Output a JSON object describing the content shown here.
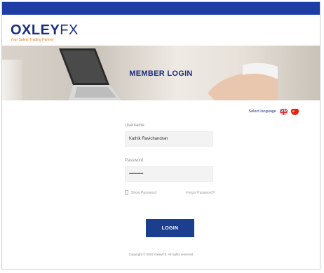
{
  "brand": {
    "name_primary": "OXLEY",
    "name_secondary": "FX",
    "tagline": "Your Safest Trading Partner"
  },
  "hero": {
    "title": "MEMBER LOGIN"
  },
  "language": {
    "label": "Select language",
    "options": [
      "uk-flag-icon",
      "china-flag-icon"
    ]
  },
  "form": {
    "username_label": "Username",
    "username_value": "Kathik Ravichandran",
    "password_label": "Password",
    "password_value": "••••••••••••••••",
    "show_password_label": "Show Password",
    "forgot_password_label": "Forgot Password?",
    "login_label": "LOGIN"
  },
  "footer": {
    "copyright": "Copyright © 2019 OxleyFX. All rights reserved"
  },
  "colors": {
    "topbar": "#1f3ea5",
    "brand_blue": "#1b2f7f",
    "button": "#1b3e8f",
    "tagline_orange": "#e07a1f"
  }
}
